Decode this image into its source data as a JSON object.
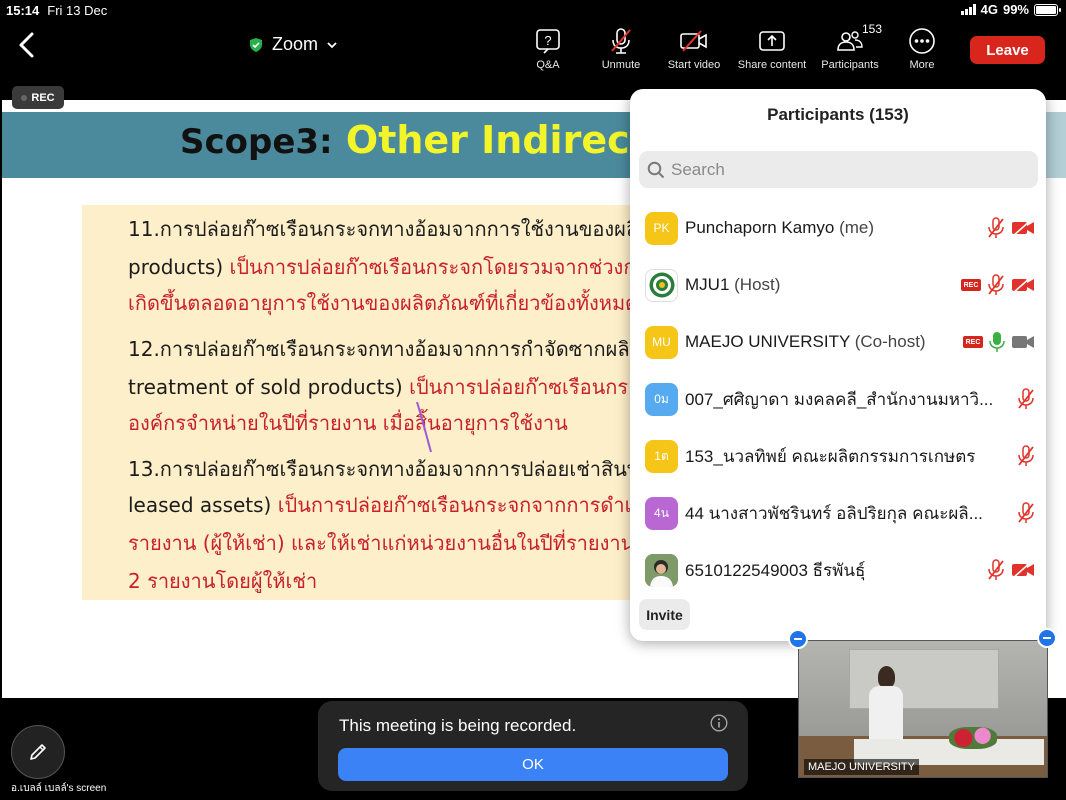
{
  "status_bar": {
    "time": "15:14",
    "date": "Fri 13 Dec",
    "network": "4G",
    "battery": "99%",
    "battery_level": 0.99
  },
  "toolbar": {
    "app_title": "Zoom",
    "buttons": [
      {
        "label": "Q&A",
        "icon": "qa-icon"
      },
      {
        "label": "Unmute",
        "icon": "mic-muted-icon"
      },
      {
        "label": "Start video",
        "icon": "video-off-icon"
      },
      {
        "label": "Share content",
        "icon": "share-icon"
      },
      {
        "label": "Participants",
        "icon": "participants-icon",
        "badge": "153"
      },
      {
        "label": "More",
        "icon": "more-icon"
      }
    ],
    "leave_label": "Leave"
  },
  "recording_badge": "REC",
  "slide": {
    "title_part1": "Scope3:",
    "title_part2": "Other Indirect",
    "lines": [
      {
        "text": "11.การปล่อยก๊าซเรือนกระจกทางอ้อมจากการใช้งานของผลิ",
        "color": "black"
      },
      {
        "text": "products)",
        "text2": " เป็นการปล่อยก๊าซเรือนกระจกโดยรวมจากช่วงก",
        "color": "mixed"
      },
      {
        "text": "เกิดขึ้นตลอดอายุการใช้งานของผลิตภัณฑ์ที่เกี่ยวข้องทั้งหมด",
        "color": "red"
      },
      {
        "text": "12.การปล่อยก๊าซเรือนกระจกทางอ้อมจากการกำจัดซากผลิต",
        "color": "black"
      },
      {
        "text": "treatment of sold products)",
        "text2": " เป็นการปล่อยก๊าซเรือนกร",
        "color": "mixed"
      },
      {
        "text": "องค์กรจำหน่ายในปีที่รายงาน เมื่อสิ้นอายุการใช้งาน",
        "color": "red"
      },
      {
        "text": "13.การปล่อยก๊าซเรือนกระจกทางอ้อมจากการปล่อยเช่าสินท",
        "color": "black"
      },
      {
        "text": "leased assets)",
        "text2": " เป็นการปล่อยก๊าซเรือนกระจกจากการดำเนิ",
        "color": "mixed"
      },
      {
        "text": "รายงาน (ผู้ให้เช่า) และให้เช่าแก่หน่วยงานอื่นในปีที่รายงานไ",
        "color": "red"
      },
      {
        "text": "2 รายงานโดยผู้ให้เช่า",
        "color": "red"
      }
    ]
  },
  "participants_panel": {
    "title": "Participants (153)",
    "search_placeholder": "Search",
    "invite_label": "Invite",
    "participants": [
      {
        "initials": "PK",
        "avatar_color": "#f5c518",
        "name": "Punchaporn Kamyo",
        "role": "(me)",
        "rec": false,
        "mic": "muted",
        "video": "off"
      },
      {
        "initials": "",
        "avatar_color": "#ffffff",
        "name": "MJU1",
        "role": "(Host)",
        "rec": true,
        "mic": "muted",
        "video": "off"
      },
      {
        "initials": "MU",
        "avatar_color": "#f5c518",
        "name": "MAEJO UNIVERSITY",
        "role": "(Co-host)",
        "rec": true,
        "mic": "on",
        "video": "on"
      },
      {
        "initials": "0ม",
        "avatar_color": "#56aaf0",
        "name": "007_ศศิญาดา มงคลคลี_สำนักงานมหาวิ...",
        "role": "",
        "rec": false,
        "mic": "muted",
        "video": ""
      },
      {
        "initials": "1ต",
        "avatar_color": "#f5c518",
        "name": "153_นวลทิพย์ คณะผลิตกรรมการเกษตร",
        "role": "",
        "rec": false,
        "mic": "muted",
        "video": ""
      },
      {
        "initials": "4น",
        "avatar_color": "#b867d3",
        "name": "44 นางสาวพัชรินทร์ อลิปริยกุล คณะผลิ...",
        "role": "",
        "rec": false,
        "mic": "muted",
        "video": ""
      },
      {
        "initials": "",
        "avatar_color": "#6b8a5a",
        "name": "6510122549003 ธีรพันธุ์",
        "role": "",
        "rec": false,
        "mic": "muted",
        "video": "off"
      }
    ]
  },
  "video_thumbnail": {
    "label": "MAEJO UNIVERSITY"
  },
  "notice": {
    "text": "This meeting is being recorded.",
    "ok_label": "OK"
  },
  "screen_label": "อ.เบลล์ เบลล์'s screen",
  "colors": {
    "leave": "#d9261c",
    "accent_blue": "#3b82f6",
    "slide_header": "#4a8a9c",
    "slide_title_yellow": "#f2f52a",
    "slide_red": "#c8202c",
    "muted_red": "#e0332b",
    "mic_green": "#3cb043"
  }
}
